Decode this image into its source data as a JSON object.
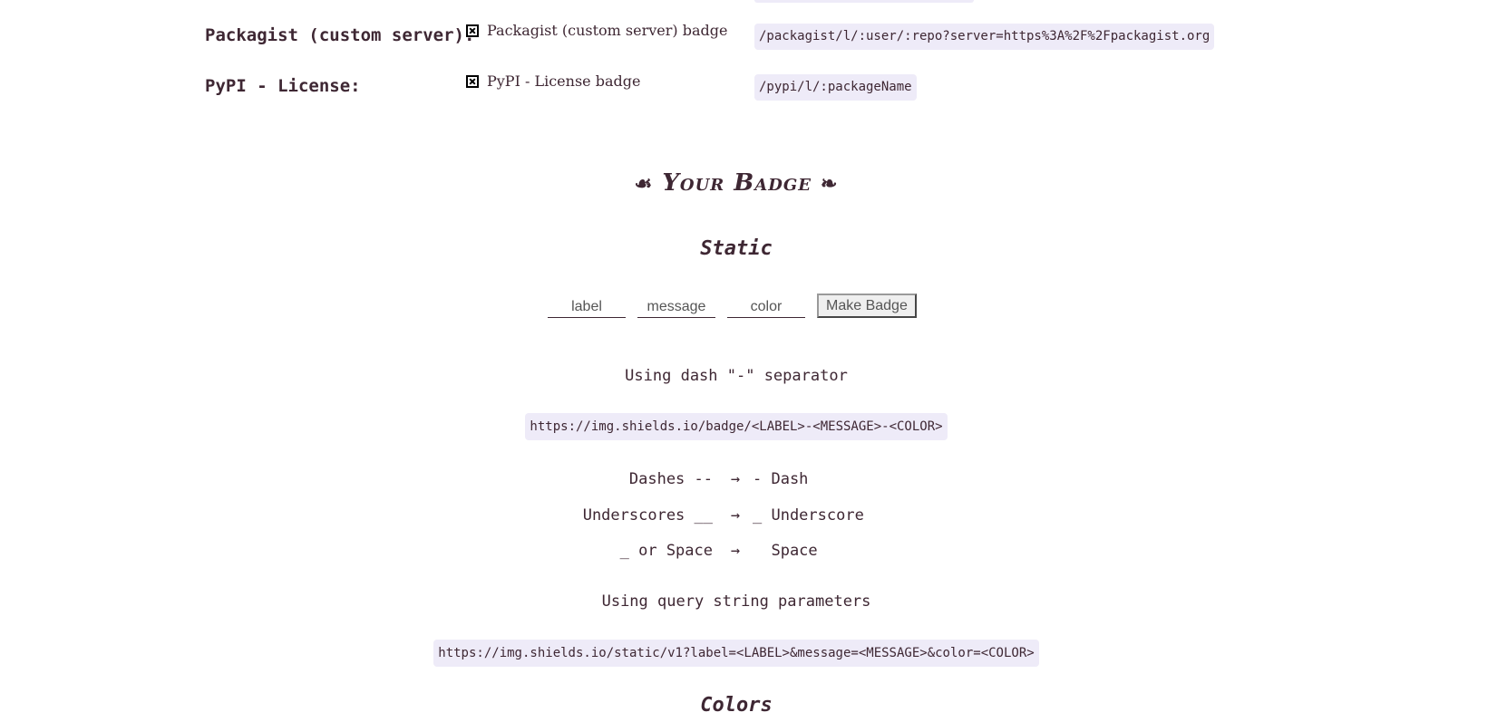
{
  "examples": [
    {
      "label": "Packagist (custom server):",
      "badge_alt": "Packagist (custom server) badge",
      "path": "/packagist/l/:user/:repo?server=https%3A%2F%2Fpackagist.org"
    },
    {
      "label": "PyPI - License:",
      "badge_alt": "PyPI - License badge",
      "path": "/pypi/l/:packageName"
    }
  ],
  "your_badge": {
    "left_ornament": "☙",
    "title": "Your Badge",
    "right_ornament": "❧"
  },
  "static": {
    "title": "Static",
    "label_placeholder": "label",
    "message_placeholder": "message",
    "color_placeholder": "color",
    "button_label": "Make Badge"
  },
  "dash": {
    "heading": "Using dash \"-\" separator",
    "url": "https://img.shields.io/badge/<LABEL>-<MESSAGE>-<COLOR>",
    "rules": [
      {
        "from": "Dashes --",
        "arrow": "→",
        "to": "- Dash"
      },
      {
        "from": "Underscores __",
        "arrow": "→",
        "to": "_ Underscore"
      },
      {
        "from": "_ or Space",
        "arrow": "→",
        "to": "  Space"
      }
    ]
  },
  "query": {
    "heading": "Using query string parameters",
    "url": "https://img.shields.io/static/v1?label=<LABEL>&message=<MESSAGE>&color=<COLOR>"
  },
  "colors": {
    "title": "Colors"
  },
  "theme": {
    "text": "#3e2733",
    "code_bg": "#eeebf8"
  }
}
